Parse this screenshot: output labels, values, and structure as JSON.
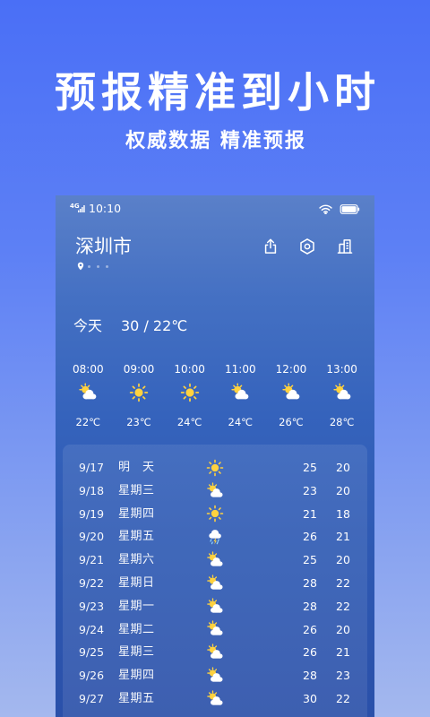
{
  "promo": {
    "headline": "预报精准到小时",
    "subheadline": "权威数据 精准预报"
  },
  "status_bar": {
    "network_type": "4G",
    "signal_bars": 4,
    "time": "10:10",
    "wifi_icon": "wifi-icon",
    "battery_icon": "battery-icon",
    "battery_level": 1.0
  },
  "header": {
    "city": "深圳市",
    "location_icon": "location-pin-icon",
    "page_count": 3,
    "actions": [
      {
        "icon": "share-icon"
      },
      {
        "icon": "gear-icon"
      },
      {
        "icon": "city-manage-icon"
      }
    ]
  },
  "today": {
    "label": "今天",
    "temperature_range": "30 / 22℃"
  },
  "hourly": [
    {
      "time": "08:00",
      "icon": "partly-cloudy-icon",
      "temp": "22℃"
    },
    {
      "time": "09:00",
      "icon": "sun-icon",
      "temp": "23℃"
    },
    {
      "time": "10:00",
      "icon": "sun-icon",
      "temp": "24℃"
    },
    {
      "time": "11:00",
      "icon": "partly-cloudy-icon",
      "temp": "24℃"
    },
    {
      "time": "12:00",
      "icon": "partly-cloudy-icon",
      "temp": "26℃"
    },
    {
      "time": "13:00",
      "icon": "partly-cloudy-icon",
      "temp": "28℃"
    }
  ],
  "daily": [
    {
      "date": "9/17",
      "day": "明 天",
      "icon": "sun-icon",
      "high": "25",
      "low": "20"
    },
    {
      "date": "9/18",
      "day": "星期三",
      "icon": "partly-cloudy-icon",
      "high": "23",
      "low": "20"
    },
    {
      "date": "9/19",
      "day": "星期四",
      "icon": "sun-icon",
      "high": "21",
      "low": "18"
    },
    {
      "date": "9/20",
      "day": "星期五",
      "icon": "thunder-rain-icon",
      "high": "26",
      "low": "21"
    },
    {
      "date": "9/21",
      "day": "星期六",
      "icon": "partly-cloudy-icon",
      "high": "25",
      "low": "20"
    },
    {
      "date": "9/22",
      "day": "星期日",
      "icon": "partly-cloudy-icon",
      "high": "28",
      "low": "22"
    },
    {
      "date": "9/23",
      "day": "星期一",
      "icon": "partly-cloudy-icon",
      "high": "28",
      "low": "22"
    },
    {
      "date": "9/24",
      "day": "星期二",
      "icon": "partly-cloudy-icon",
      "high": "26",
      "low": "20"
    },
    {
      "date": "9/25",
      "day": "星期三",
      "icon": "partly-cloudy-icon",
      "high": "26",
      "low": "21"
    },
    {
      "date": "9/26",
      "day": "星期四",
      "icon": "partly-cloudy-icon",
      "high": "28",
      "low": "23"
    },
    {
      "date": "9/27",
      "day": "星期五",
      "icon": "partly-cloudy-icon",
      "high": "30",
      "low": "22"
    }
  ],
  "colors": {
    "sun": "#ffd23f",
    "cloud": "#ffffff",
    "rain": "#8fd3ff"
  }
}
